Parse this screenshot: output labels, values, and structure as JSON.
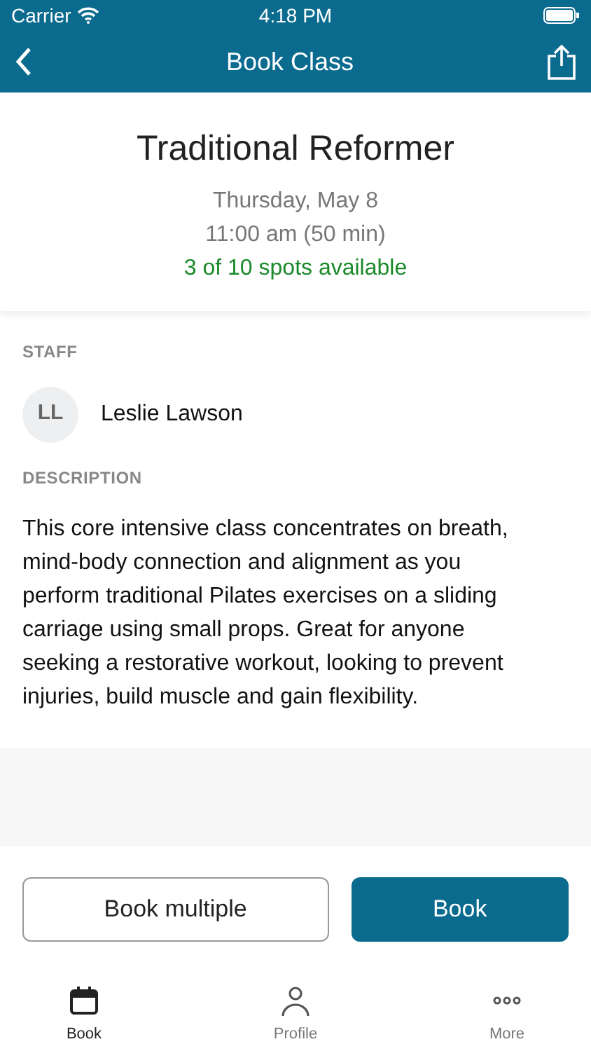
{
  "status_bar": {
    "carrier": "Carrier",
    "time": "4:18 PM"
  },
  "nav": {
    "title": "Book Class"
  },
  "class": {
    "name": "Traditional Reformer",
    "date": "Thursday, May 8",
    "time": "11:00 am (50 min)",
    "availability": "3 of 10 spots available"
  },
  "staff": {
    "heading": "STAFF",
    "initials": "LL",
    "name": "Leslie Lawson"
  },
  "description": {
    "heading": "DESCRIPTION",
    "text": "This core intensive class concentrates on breath, mind-body connection and alignment as you perform traditional Pilates exercises on a sliding carriage using small props. Great for anyone seeking a restorative workout, looking to prevent injuries, build muscle and gain flexibility."
  },
  "buttons": [
    {
      "label": "Book multiple",
      "kind": "outline"
    },
    {
      "label": "Book",
      "kind": "primary"
    }
  ],
  "tabs": [
    {
      "label": "Book",
      "kind": "calendar",
      "selected": true
    },
    {
      "label": "Profile",
      "kind": "person",
      "selected": false
    },
    {
      "label": "More",
      "kind": "more",
      "selected": false
    }
  ]
}
